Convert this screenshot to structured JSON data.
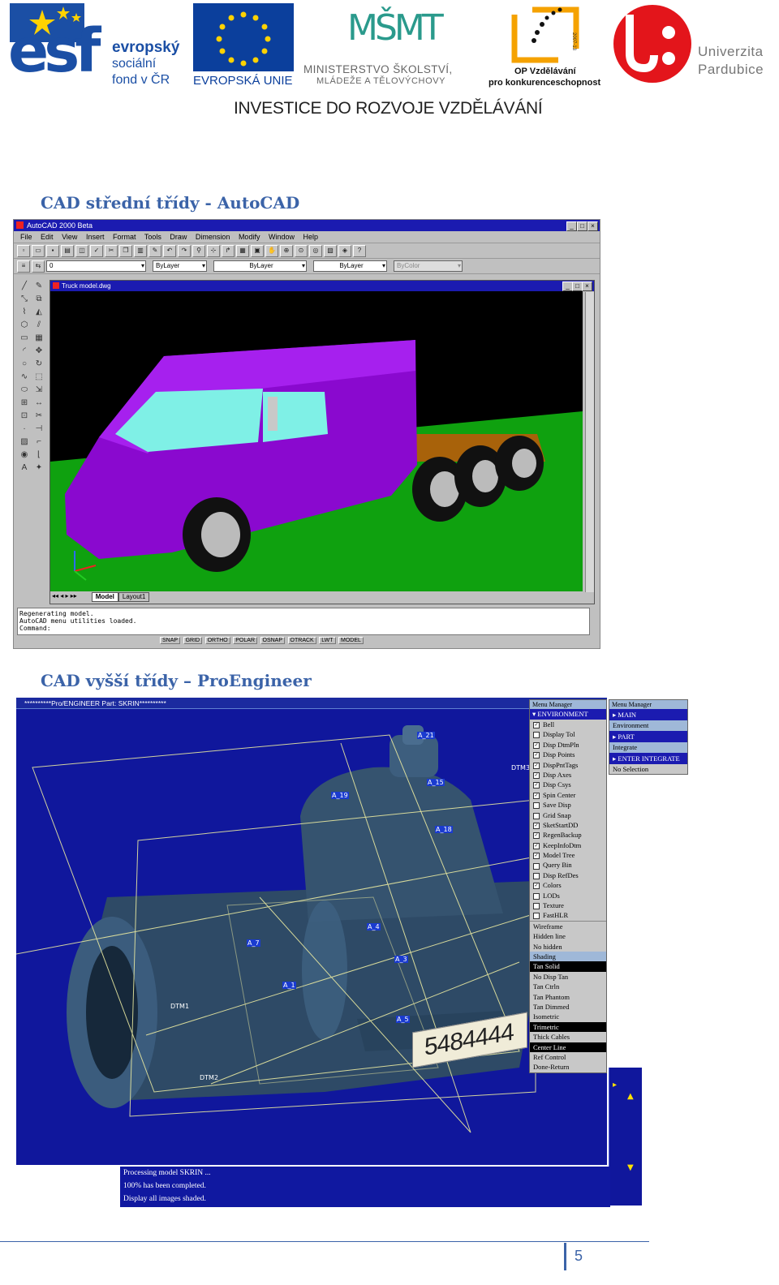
{
  "logos": {
    "esf": {
      "letters": "esf",
      "line1": "evropský",
      "line2": "sociální",
      "line3": "fond v ČR"
    },
    "eu": {
      "caption": "EVROPSKÁ UNIE"
    },
    "msmt": {
      "letters": "MŠMT",
      "line1": "MINISTERSTVO ŠKOLSTVÍ,",
      "line2": "MLÁDEŽE A TĚLOVÝCHOVY"
    },
    "op": {
      "line1": "OP Vzdělávání",
      "line2": "pro konkurenceschopnost",
      "years": "2007-13"
    },
    "upce": {
      "line1": "Univerzita",
      "line2": "Pardubice"
    }
  },
  "banner": "INVESTICE DO ROZVOJE VZDĚLÁVÁNÍ",
  "section1_title": "CAD střední třídy - AutoCAD",
  "autocad": {
    "title": "AutoCAD 2000 Beta",
    "menu": [
      "File",
      "Edit",
      "View",
      "Insert",
      "Format",
      "Tools",
      "Draw",
      "Dimension",
      "Modify",
      "Window",
      "Help"
    ],
    "layer_value": "0",
    "color_value": "ByLayer",
    "linetype_value": "ByLayer",
    "lineweight_value": "ByLayer",
    "plotstyle_value": "ByColor",
    "drawing_title": "Truck model.dwg",
    "tabs": [
      "Model",
      "Layout1"
    ],
    "command_lines": [
      "Regenerating model.",
      "AutoCAD menu utilities loaded.",
      "Command:"
    ],
    "status": [
      "SNAP",
      "GRID",
      "ORTHO",
      "POLAR",
      "OSNAP",
      "OTRACK",
      "LWT",
      "MODEL"
    ]
  },
  "section2_title": "CAD vyšší třídy – ProEngineer",
  "proe": {
    "title": "**********Pro/ENGINEER Part: SKRIN**********",
    "datum_labels": [
      "A_21",
      "A_15",
      "A_19",
      "A_18",
      "A_7",
      "A_4",
      "A_3",
      "A_5",
      "DTM1",
      "DTM2",
      "DTM3",
      "A_1"
    ],
    "part_number": "5484444",
    "menu1": {
      "header": "Menu Manager",
      "title": "ENVIRONMENT",
      "items": [
        {
          "label": "Bell",
          "checked": true
        },
        {
          "label": "Display Tol",
          "checked": false
        },
        {
          "label": "Disp DtmPln",
          "checked": true
        },
        {
          "label": "Disp Points",
          "checked": true
        },
        {
          "label": "DispPntTags",
          "checked": true
        },
        {
          "label": "Disp Axes",
          "checked": true
        },
        {
          "label": "Disp Csys",
          "checked": true
        },
        {
          "label": "Spin Center",
          "checked": true
        },
        {
          "label": "Save Disp",
          "checked": false
        },
        {
          "label": "Grid Snap",
          "checked": false
        },
        {
          "label": "SketStartDD",
          "checked": true
        },
        {
          "label": "RegenBackup",
          "checked": true
        },
        {
          "label": "KeepInfoDtm",
          "checked": true
        },
        {
          "label": "Model Tree",
          "checked": true
        },
        {
          "label": "Query Bin",
          "checked": false
        },
        {
          "label": "Disp RefDes",
          "checked": false
        },
        {
          "label": "Colors",
          "checked": true
        },
        {
          "label": "LODs",
          "checked": false
        },
        {
          "label": "Texture",
          "checked": false
        },
        {
          "label": "FastHLR",
          "checked": false
        }
      ],
      "options": [
        {
          "label": "Wireframe",
          "style": "normal"
        },
        {
          "label": "Hidden line",
          "style": "normal"
        },
        {
          "label": "No hidden",
          "style": "normal"
        },
        {
          "label": "Shading",
          "style": "sel"
        },
        {
          "label": "Tan Solid",
          "style": "hl"
        },
        {
          "label": "No Disp Tan",
          "style": "normal"
        },
        {
          "label": "Tan Ctrln",
          "style": "normal"
        },
        {
          "label": "Tan Phantom",
          "style": "normal"
        },
        {
          "label": "Tan Dimmed",
          "style": "normal"
        },
        {
          "label": "Isometric",
          "style": "normal"
        },
        {
          "label": "Trimetric",
          "style": "hl"
        },
        {
          "label": "Thick Cables",
          "style": "normal"
        },
        {
          "label": "Center Line",
          "style": "hl"
        },
        {
          "label": "Ref Control",
          "style": "normal"
        },
        {
          "label": "Done-Return",
          "style": "normal"
        }
      ]
    },
    "menu2": {
      "header": "Menu Manager",
      "items": [
        {
          "label": "MAIN",
          "style": "head"
        },
        {
          "label": "Environment",
          "style": "sel"
        },
        {
          "label": "PART",
          "style": "head"
        },
        {
          "label": "Integrate",
          "style": "sel"
        },
        {
          "label": "ENTER INTEGRATE",
          "style": "head"
        },
        {
          "label": "No Selection",
          "style": "normal"
        }
      ]
    },
    "messages": [
      "Processing model SKRIN ...",
      "100% has been completed.",
      "Display all images shaded."
    ]
  },
  "page_number": "5",
  "colors": {
    "heading": "#3b63a8",
    "esf_blue": "#1b4fa5",
    "eu_blue": "#0b3f9c",
    "msmt_teal": "#2a9a8c",
    "upce_red": "#e3151b",
    "proe_bg": "#10179c"
  }
}
